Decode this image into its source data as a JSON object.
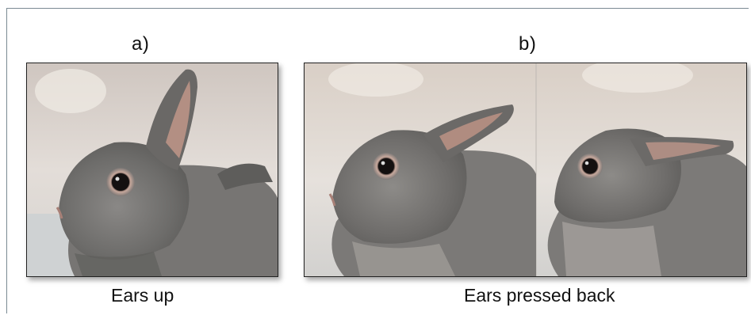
{
  "labels": {
    "panel_a": "a)",
    "panel_b": "b)"
  },
  "captions": {
    "left": "Ears up",
    "right": "Ears pressed back"
  },
  "colors": {
    "fur_gray": "#6f6e6c",
    "fur_light": "#9a9895",
    "background_wall": "#dcd7d2",
    "ear_inner": "#b89488",
    "eye": "#1a1413"
  }
}
